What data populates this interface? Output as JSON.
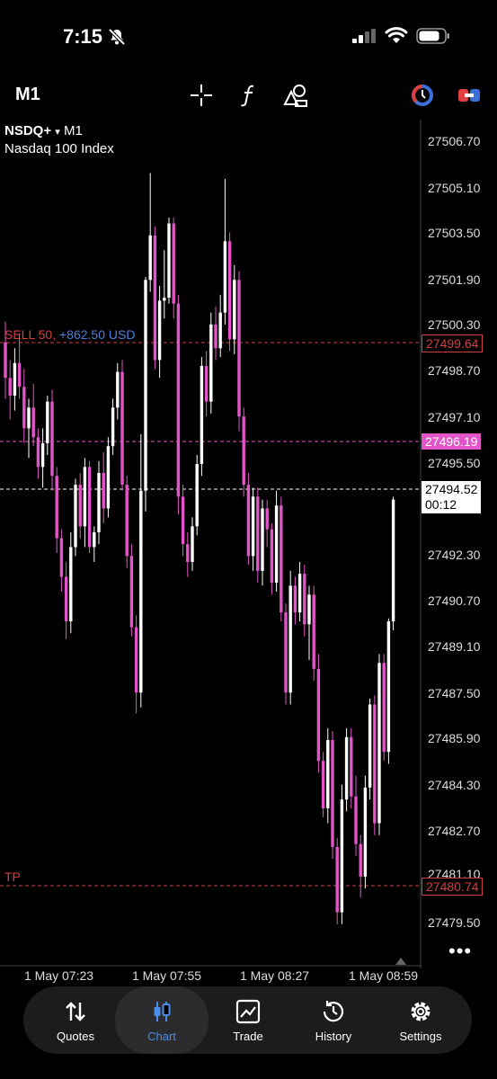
{
  "status_bar": {
    "time": "7:15",
    "icons": [
      "bell-slash-icon",
      "cellular-signal-icon",
      "wifi-icon",
      "battery-icon"
    ]
  },
  "toolbar": {
    "timeframe": "M1",
    "icons": [
      "crosshair-icon",
      "indicator-f-icon",
      "objects-icon",
      "one-click-trading-icon",
      "trade-position-icon"
    ]
  },
  "chart": {
    "symbol": "NSDQ+",
    "dropdown_glyph": "▾",
    "timeframe": "M1",
    "description": "Nasdaq 100 Index",
    "price_axis": [
      "27506.70",
      "27505.10",
      "27503.50",
      "27501.90",
      "27500.30",
      "27498.70",
      "27497.10",
      "27495.50",
      "27492.30",
      "27490.70",
      "27489.10",
      "27487.50",
      "27485.90",
      "27484.30",
      "27482.70",
      "27481.10",
      "27479.50"
    ],
    "sell_order": {
      "side_lots": "SELL 50,",
      "profit": "+862.50 USD",
      "price": "27499.64",
      "color": "#d04040",
      "profit_color": "#4f7fd8"
    },
    "bid_line": {
      "price": "27496.19",
      "color": "#e255c8"
    },
    "current_price": {
      "price": "27494.52",
      "countdown": "00:12"
    },
    "tp_line": {
      "label": "TP",
      "price": "27480.74",
      "color": "#d04040"
    },
    "time_axis": [
      "1 May 07:23",
      "1 May 07:55",
      "1 May 08:27",
      "1 May 08:59"
    ],
    "more_glyph": "•••",
    "bull_color": "#ffffff",
    "bear_color": "#e255c8"
  },
  "chart_data": {
    "type": "candlestick",
    "title": "NSDQ+ M1 Nasdaq 100 Index",
    "ylim": [
      27478.8,
      27507.3
    ],
    "x_labels": [
      "1 May 07:23",
      "1 May 07:55",
      "1 May 08:27",
      "1 May 08:59"
    ],
    "candles": [
      [
        27499.8,
        27500.5,
        27497.9,
        27498.6
      ],
      [
        27498.6,
        27499.2,
        27497.2,
        27498.0
      ],
      [
        27498.0,
        27499.6,
        27497.5,
        27499.1
      ],
      [
        27499.1,
        27500.1,
        27497.9,
        27498.3
      ],
      [
        27498.3,
        27498.9,
        27496.4,
        27496.9
      ],
      [
        27496.9,
        27497.9,
        27495.9,
        27497.6
      ],
      [
        27497.6,
        27498.4,
        27496.3,
        27496.6
      ],
      [
        27496.6,
        27496.9,
        27495.2,
        27495.6
      ],
      [
        27495.6,
        27496.9,
        27494.9,
        27496.4
      ],
      [
        27496.4,
        27498.0,
        27496.0,
        27497.8
      ],
      [
        27497.8,
        27498.2,
        27494.8,
        27495.3
      ],
      [
        27495.3,
        27495.6,
        27492.7,
        27493.2
      ],
      [
        27493.2,
        27493.5,
        27491.4,
        27491.9
      ],
      [
        27491.9,
        27492.4,
        27489.8,
        27490.4
      ],
      [
        27490.4,
        27493.4,
        27490.0,
        27492.9
      ],
      [
        27492.9,
        27495.2,
        27492.6,
        27495.0
      ],
      [
        27495.0,
        27495.4,
        27493.2,
        27493.6
      ],
      [
        27493.6,
        27495.9,
        27492.9,
        27495.6
      ],
      [
        27495.6,
        27495.8,
        27492.7,
        27492.9
      ],
      [
        27492.9,
        27493.6,
        27492.4,
        27493.4
      ],
      [
        27493.4,
        27495.8,
        27493.0,
        27495.4
      ],
      [
        27495.4,
        27496.1,
        27493.7,
        27494.2
      ],
      [
        27494.2,
        27496.6,
        27493.9,
        27496.3
      ],
      [
        27496.3,
        27497.9,
        27496.0,
        27497.6
      ],
      [
        27497.6,
        27499.1,
        27497.2,
        27498.8
      ],
      [
        27498.8,
        27499.2,
        27494.8,
        27495.0
      ],
      [
        27495.0,
        27495.3,
        27492.2,
        27492.6
      ],
      [
        27492.6,
        27493.0,
        27489.9,
        27490.2
      ],
      [
        27490.2,
        27490.6,
        27487.3,
        27488.0
      ],
      [
        27488.0,
        27496.7,
        27487.5,
        27494.8
      ],
      [
        27494.8,
        27502.0,
        27494.1,
        27501.9
      ],
      [
        27501.9,
        27505.5,
        27501.5,
        27503.4
      ],
      [
        27503.4,
        27503.7,
        27498.9,
        27499.2
      ],
      [
        27499.2,
        27501.7,
        27498.6,
        27501.2
      ],
      [
        27501.2,
        27502.9,
        27500.6,
        27501.3
      ],
      [
        27501.3,
        27504.0,
        27501.1,
        27503.8
      ],
      [
        27503.8,
        27504.0,
        27500.6,
        27501.1
      ],
      [
        27501.1,
        27501.4,
        27494.0,
        27494.6
      ],
      [
        27494.6,
        27495.0,
        27492.6,
        27493.0
      ],
      [
        27493.0,
        27493.4,
        27491.9,
        27492.4
      ],
      [
        27492.4,
        27493.9,
        27492.1,
        27493.6
      ],
      [
        27493.6,
        27496.0,
        27493.3,
        27495.7
      ],
      [
        27495.7,
        27499.3,
        27495.3,
        27499.0
      ],
      [
        27499.0,
        27499.5,
        27497.3,
        27497.8
      ],
      [
        27497.8,
        27500.8,
        27497.4,
        27500.4
      ],
      [
        27500.4,
        27501.0,
        27499.2,
        27499.6
      ],
      [
        27499.6,
        27501.4,
        27499.3,
        27500.8
      ],
      [
        27500.8,
        27505.3,
        27500.4,
        27503.2
      ],
      [
        27503.2,
        27503.5,
        27499.5,
        27499.9
      ],
      [
        27499.9,
        27502.4,
        27499.4,
        27501.9
      ],
      [
        27501.9,
        27502.2,
        27496.8,
        27497.3
      ],
      [
        27497.3,
        27497.6,
        27494.6,
        27495.0
      ],
      [
        27495.0,
        27495.4,
        27492.3,
        27492.6
      ],
      [
        27492.6,
        27494.9,
        27492.1,
        27494.6
      ],
      [
        27494.6,
        27494.9,
        27491.7,
        27492.1
      ],
      [
        27492.1,
        27494.5,
        27491.6,
        27494.2
      ],
      [
        27494.2,
        27494.5,
        27492.9,
        27493.5
      ],
      [
        27493.5,
        27493.7,
        27491.3,
        27491.7
      ],
      [
        27491.7,
        27494.8,
        27491.4,
        27494.3
      ],
      [
        27494.3,
        27494.6,
        27490.4,
        27490.7
      ],
      [
        27490.7,
        27491.0,
        27487.6,
        27488.0
      ],
      [
        27488.0,
        27492.1,
        27487.6,
        27491.6
      ],
      [
        27491.6,
        27491.9,
        27490.3,
        27490.7
      ],
      [
        27490.7,
        27492.4,
        27490.4,
        27492.0
      ],
      [
        27492.0,
        27492.3,
        27489.9,
        27490.3
      ],
      [
        27490.3,
        27491.6,
        27489.1,
        27491.3
      ],
      [
        27491.3,
        27491.6,
        27488.4,
        27488.8
      ],
      [
        27488.8,
        27489.3,
        27485.3,
        27485.7
      ],
      [
        27485.7,
        27486.0,
        27483.8,
        27484.1
      ],
      [
        27484.1,
        27486.8,
        27483.6,
        27486.4
      ],
      [
        27486.4,
        27486.7,
        27482.4,
        27482.8
      ],
      [
        27482.8,
        27483.1,
        27480.2,
        27480.6
      ],
      [
        27480.6,
        27484.9,
        27480.2,
        27484.4
      ],
      [
        27484.4,
        27486.8,
        27484.0,
        27486.5
      ],
      [
        27486.5,
        27486.8,
        27484.1,
        27484.5
      ],
      [
        27484.5,
        27485.2,
        27482.5,
        27482.9
      ],
      [
        27482.9,
        27483.2,
        27481.1,
        27481.8
      ],
      [
        27481.8,
        27485.2,
        27481.4,
        27484.8
      ],
      [
        27484.8,
        27487.8,
        27484.4,
        27487.6
      ],
      [
        27487.6,
        27487.9,
        27483.2,
        27483.6
      ],
      [
        27483.6,
        27489.3,
        27483.2,
        27489.0
      ],
      [
        27489.0,
        27489.3,
        27485.7,
        27486.0
      ],
      [
        27486.0,
        27490.5,
        27485.6,
        27490.4
      ],
      [
        27490.4,
        27494.6,
        27490.1,
        27494.5
      ]
    ]
  }
}
